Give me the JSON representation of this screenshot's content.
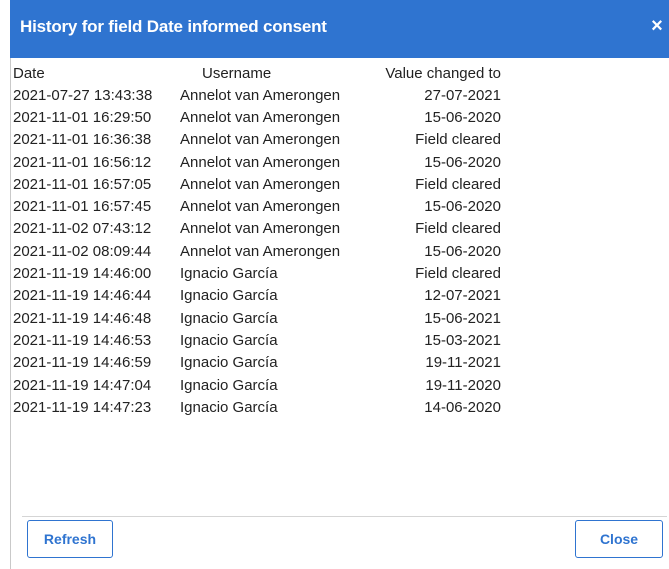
{
  "dialog": {
    "title": "History for field Date informed consent",
    "close_glyph": "×",
    "accent_color": "#2f74d0"
  },
  "table": {
    "headers": {
      "date": "Date",
      "username": "Username",
      "value": "Value changed to"
    },
    "rows": [
      {
        "date": "2021-07-27 13:43:38",
        "username": "Annelot van Amerongen",
        "value": "27-07-2021"
      },
      {
        "date": "2021-11-01 16:29:50",
        "username": "Annelot van Amerongen",
        "value": "15-06-2020"
      },
      {
        "date": "2021-11-01 16:36:38",
        "username": "Annelot van Amerongen",
        "value": "Field cleared"
      },
      {
        "date": "2021-11-01 16:56:12",
        "username": "Annelot van Amerongen",
        "value": "15-06-2020"
      },
      {
        "date": "2021-11-01 16:57:05",
        "username": "Annelot van Amerongen",
        "value": "Field cleared"
      },
      {
        "date": "2021-11-01 16:57:45",
        "username": "Annelot van Amerongen",
        "value": "15-06-2020"
      },
      {
        "date": "2021-11-02 07:43:12",
        "username": "Annelot van Amerongen",
        "value": "Field cleared"
      },
      {
        "date": "2021-11-02 08:09:44",
        "username": "Annelot van Amerongen",
        "value": "15-06-2020"
      },
      {
        "date": "2021-11-19 14:46:00",
        "username": "Ignacio García",
        "value": "Field cleared"
      },
      {
        "date": "2021-11-19 14:46:44",
        "username": "Ignacio García",
        "value": "12-07-2021"
      },
      {
        "date": "2021-11-19 14:46:48",
        "username": "Ignacio García",
        "value": "15-06-2021"
      },
      {
        "date": "2021-11-19 14:46:53",
        "username": "Ignacio García",
        "value": "15-03-2021"
      },
      {
        "date": "2021-11-19 14:46:59",
        "username": "Ignacio García",
        "value": "19-11-2021"
      },
      {
        "date": "2021-11-19 14:47:04",
        "username": "Ignacio García",
        "value": "19-11-2020"
      },
      {
        "date": "2021-11-19 14:47:23",
        "username": "Ignacio García",
        "value": "14-06-2020"
      }
    ]
  },
  "footer": {
    "refresh_label": "Refresh",
    "close_label": "Close"
  }
}
